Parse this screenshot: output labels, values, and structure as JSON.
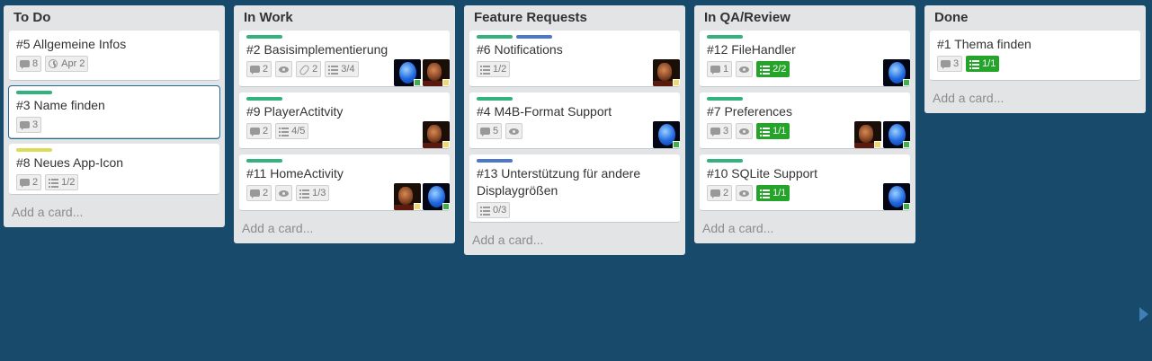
{
  "lists": [
    {
      "title": "To Do",
      "add_card": "Add a card...",
      "cards": [
        {
          "title": "#5 Allgemeine Infos",
          "labels": [],
          "badges": [
            {
              "icon": "comment",
              "text": "8"
            },
            {
              "icon": "clock",
              "text": "Apr 2"
            }
          ],
          "members": []
        },
        {
          "title": "#3 Name finden",
          "labels": [
            "#34b27d"
          ],
          "badges": [
            {
              "icon": "comment",
              "text": "3"
            }
          ],
          "members": []
        },
        {
          "title": "#8 Neues App-Icon",
          "labels": [
            "#dbdb57"
          ],
          "badges": [
            {
              "icon": "comment",
              "text": "2"
            },
            {
              "icon": "check",
              "text": "1/2"
            }
          ],
          "members": []
        }
      ]
    },
    {
      "title": "In Work",
      "add_card": "Add a card...",
      "cards": [
        {
          "title": "#2 Basisimplementierung",
          "labels": [
            "#34b27d"
          ],
          "badges": [
            {
              "icon": "comment",
              "text": "2"
            },
            {
              "icon": "eye",
              "text": ""
            },
            {
              "icon": "clip",
              "text": "2"
            },
            {
              "icon": "check",
              "text": "3/4"
            }
          ],
          "members": [
            "blue",
            "face"
          ]
        },
        {
          "title": "#9 PlayerActitvity",
          "labels": [
            "#34b27d"
          ],
          "badges": [
            {
              "icon": "comment",
              "text": "2"
            },
            {
              "icon": "check",
              "text": "4/5"
            }
          ],
          "members": [
            "face"
          ]
        },
        {
          "title": "#11 HomeActivity",
          "labels": [
            "#34b27d"
          ],
          "badges": [
            {
              "icon": "comment",
              "text": "2"
            },
            {
              "icon": "eye",
              "text": ""
            },
            {
              "icon": "check",
              "text": "1/3"
            }
          ],
          "members": [
            "face",
            "blue"
          ]
        }
      ]
    },
    {
      "title": "Feature Requests",
      "add_card": "Add a card...",
      "cards": [
        {
          "title": "#6 Notifications",
          "labels": [
            "#34b27d",
            "#4d77cb"
          ],
          "badges": [
            {
              "icon": "check",
              "text": "1/2"
            }
          ],
          "members": [
            "face"
          ]
        },
        {
          "title": "#4 M4B-Format Support",
          "labels": [
            "#34b27d"
          ],
          "badges": [
            {
              "icon": "comment",
              "text": "5"
            },
            {
              "icon": "eye",
              "text": ""
            }
          ],
          "members": [
            "blue"
          ]
        },
        {
          "title": "#13 Unterstützung für andere Displaygrößen",
          "labels": [
            "#4d77cb"
          ],
          "badges": [
            {
              "icon": "check",
              "text": "0/3"
            }
          ],
          "members": []
        }
      ]
    },
    {
      "title": "In QA/Review",
      "add_card": "Add a card...",
      "cards": [
        {
          "title": "#12 FileHandler",
          "labels": [
            "#34b27d"
          ],
          "badges": [
            {
              "icon": "comment",
              "text": "1"
            },
            {
              "icon": "eye",
              "text": ""
            },
            {
              "icon": "check",
              "text": "2/2",
              "done": true
            }
          ],
          "members": [
            "blue"
          ]
        },
        {
          "title": "#7 Preferences",
          "labels": [
            "#34b27d"
          ],
          "badges": [
            {
              "icon": "comment",
              "text": "3"
            },
            {
              "icon": "eye",
              "text": ""
            },
            {
              "icon": "check",
              "text": "1/1",
              "done": true
            }
          ],
          "members": [
            "face",
            "blue"
          ]
        },
        {
          "title": "#10 SQLite Support",
          "labels": [
            "#34b27d"
          ],
          "badges": [
            {
              "icon": "comment",
              "text": "2"
            },
            {
              "icon": "eye",
              "text": ""
            },
            {
              "icon": "check",
              "text": "1/1",
              "done": true
            }
          ],
          "members": [
            "blue"
          ]
        }
      ]
    },
    {
      "title": "Done",
      "add_card": "Add a card...",
      "cards": [
        {
          "title": "#1 Thema finden",
          "labels": [],
          "badges": [
            {
              "icon": "comment",
              "text": "3"
            },
            {
              "icon": "check",
              "text": "1/1",
              "done": true
            }
          ],
          "members": []
        }
      ]
    }
  ],
  "colors": {
    "board_background": "#174a6b",
    "list_background": "#e2e4e6",
    "label_green": "#34b27d",
    "label_yellow": "#dbdb57",
    "label_blue": "#4d77cb",
    "checklist_done": "#24a52a"
  }
}
